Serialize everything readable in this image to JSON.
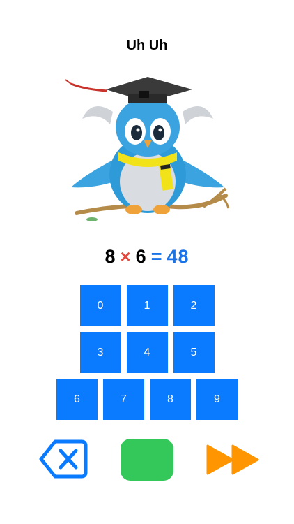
{
  "header": {
    "title": "Uh Uh"
  },
  "equation": {
    "a": "8",
    "operator": "×",
    "b": "6",
    "equals": "=",
    "answer": "48"
  },
  "keypad": {
    "row1": [
      "0",
      "1",
      "2"
    ],
    "row2": [
      "3",
      "4",
      "5"
    ],
    "row3": [
      "6",
      "7",
      "8",
      "9"
    ]
  },
  "controls": {
    "backspace_icon": "backspace-x-icon",
    "submit_color": "#34c759",
    "skip_icon": "fast-forward-icon"
  },
  "colors": {
    "key": "#0a7afe",
    "operator": "#e5473b",
    "answer": "#1a73e8",
    "skip": "#ff9500"
  }
}
